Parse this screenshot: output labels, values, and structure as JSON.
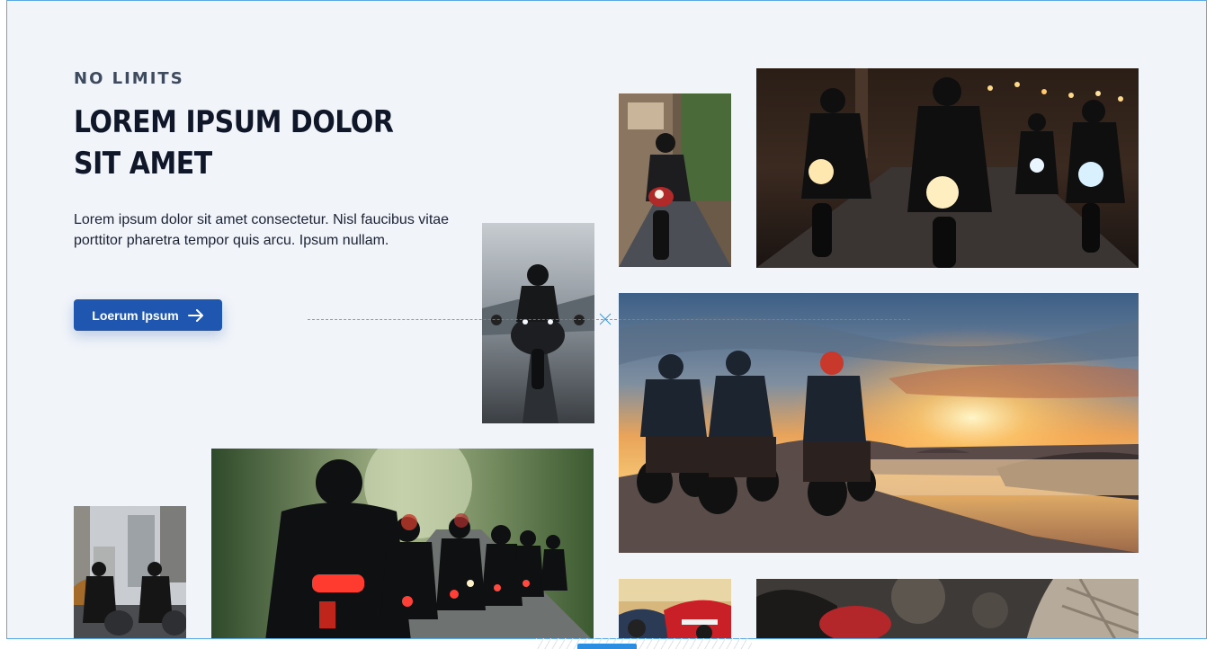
{
  "hero": {
    "eyebrow": "NO LIMITS",
    "title": "LOREM IPSUM DOLOR SIT AMET",
    "description": "Lorem ipsum dolor sit amet consectetur. Nisl faucibus vitae porttitor pharetra tempor quis arcu. Ipsum nullam.",
    "cta_label": "Loerum Ipsum",
    "cta_icon": "arrow-right-icon"
  },
  "colors": {
    "background": "#f1f4f9",
    "accent": "#1f57b0",
    "frame_border": "#5aa9e6",
    "heading": "#0f1728"
  },
  "gallery": {
    "photos": [
      {
        "name": "photo-rider-highway-front"
      },
      {
        "name": "photo-rider-city-street"
      },
      {
        "name": "photo-riders-night-group"
      },
      {
        "name": "photo-riders-sunset-cliff"
      },
      {
        "name": "photo-riders-city-skyline"
      },
      {
        "name": "photo-riders-forest-road"
      },
      {
        "name": "photo-motorcycle-showroom"
      },
      {
        "name": "photo-rider-closeup"
      }
    ]
  }
}
